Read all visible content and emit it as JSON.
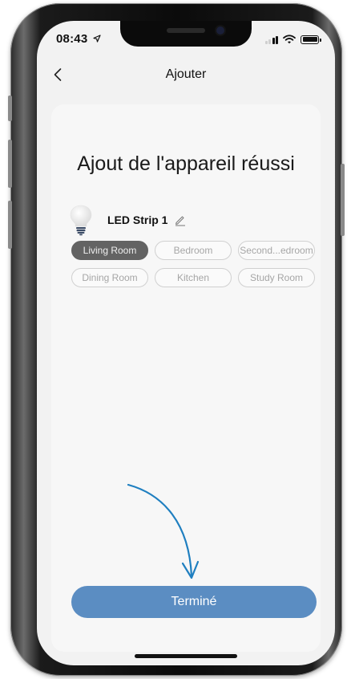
{
  "status_bar": {
    "time": "08:43",
    "location_icon": "location-arrow-icon",
    "icons": [
      "cellular-signal-icon",
      "wifi-icon",
      "battery-icon"
    ]
  },
  "nav": {
    "back_icon": "chevron-left-icon",
    "title": "Ajouter"
  },
  "success": {
    "headline": "Ajout de l'appareil réussi"
  },
  "device": {
    "icon": "light-bulb-icon",
    "name": "LED Strip 1",
    "edit_icon": "pencil-icon"
  },
  "rooms": {
    "selected": "Living Room",
    "items": [
      {
        "label": "Living Room",
        "selected": true
      },
      {
        "label": "Bedroom",
        "selected": false
      },
      {
        "label": "Second...edroom",
        "selected": false
      },
      {
        "label": "Dining Room",
        "selected": false
      },
      {
        "label": "Kitchen",
        "selected": false
      },
      {
        "label": "Study Room",
        "selected": false
      }
    ]
  },
  "annotation": {
    "icon": "curved-arrow-icon",
    "color": "#1f7fc0"
  },
  "footer": {
    "done_label": "Terminé"
  },
  "colors": {
    "button": "#5b8dc2",
    "chip_selected": "#636363",
    "background": "#f2f2f2",
    "card": "#f7f7f7"
  }
}
